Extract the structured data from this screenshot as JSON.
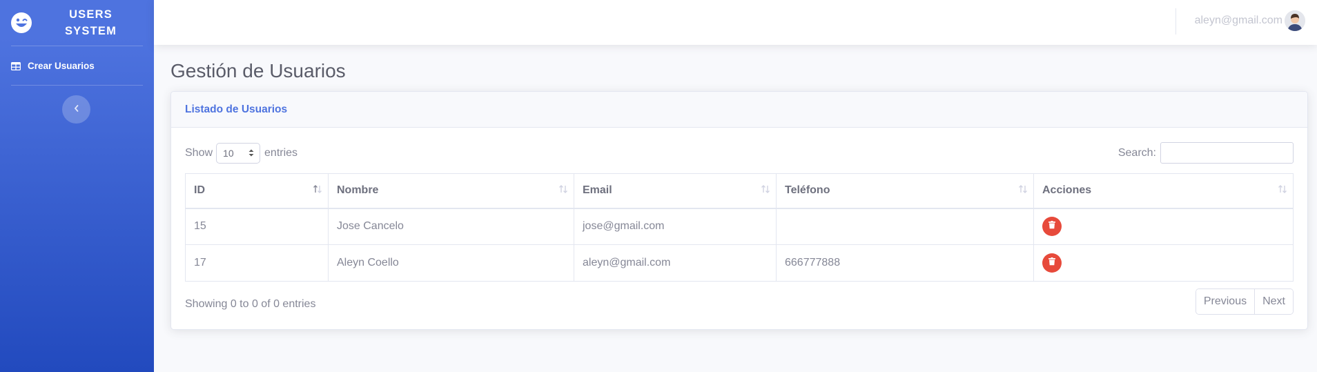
{
  "sidebar": {
    "brand": {
      "icon": "laugh-wink-icon",
      "line1": "USERS",
      "line2": "SYSTEM"
    },
    "items": [
      {
        "label": "Crear Usuarios",
        "icon": "table-icon"
      }
    ],
    "toggle_icon": "chevron-left-icon"
  },
  "topbar": {
    "user_email": "aleyn@gmail.com",
    "avatar_icon": "user-avatar"
  },
  "page": {
    "title": "Gestión de Usuarios"
  },
  "card": {
    "title": "Listado de Usuarios",
    "length": {
      "show_label": "Show",
      "selected": "10",
      "entries_label": "entries"
    },
    "search": {
      "label": "Search:",
      "value": "",
      "placeholder": ""
    },
    "columns": [
      "ID",
      "Nombre",
      "Email",
      "Teléfono",
      "Acciones"
    ],
    "rows": [
      {
        "id": "15",
        "nombre": "Jose Cancelo",
        "email": "jose@gmail.com",
        "telefono": ""
      },
      {
        "id": "17",
        "nombre": "Aleyn Coello",
        "email": "aleyn@gmail.com",
        "telefono": "666777888"
      }
    ],
    "info": "Showing 0 to 0 of 0 entries",
    "pagination": {
      "previous": "Previous",
      "next": "Next"
    }
  },
  "colors": {
    "primary": "#4e73df",
    "danger": "#e74a3b",
    "sidebar_end": "#224abe"
  }
}
